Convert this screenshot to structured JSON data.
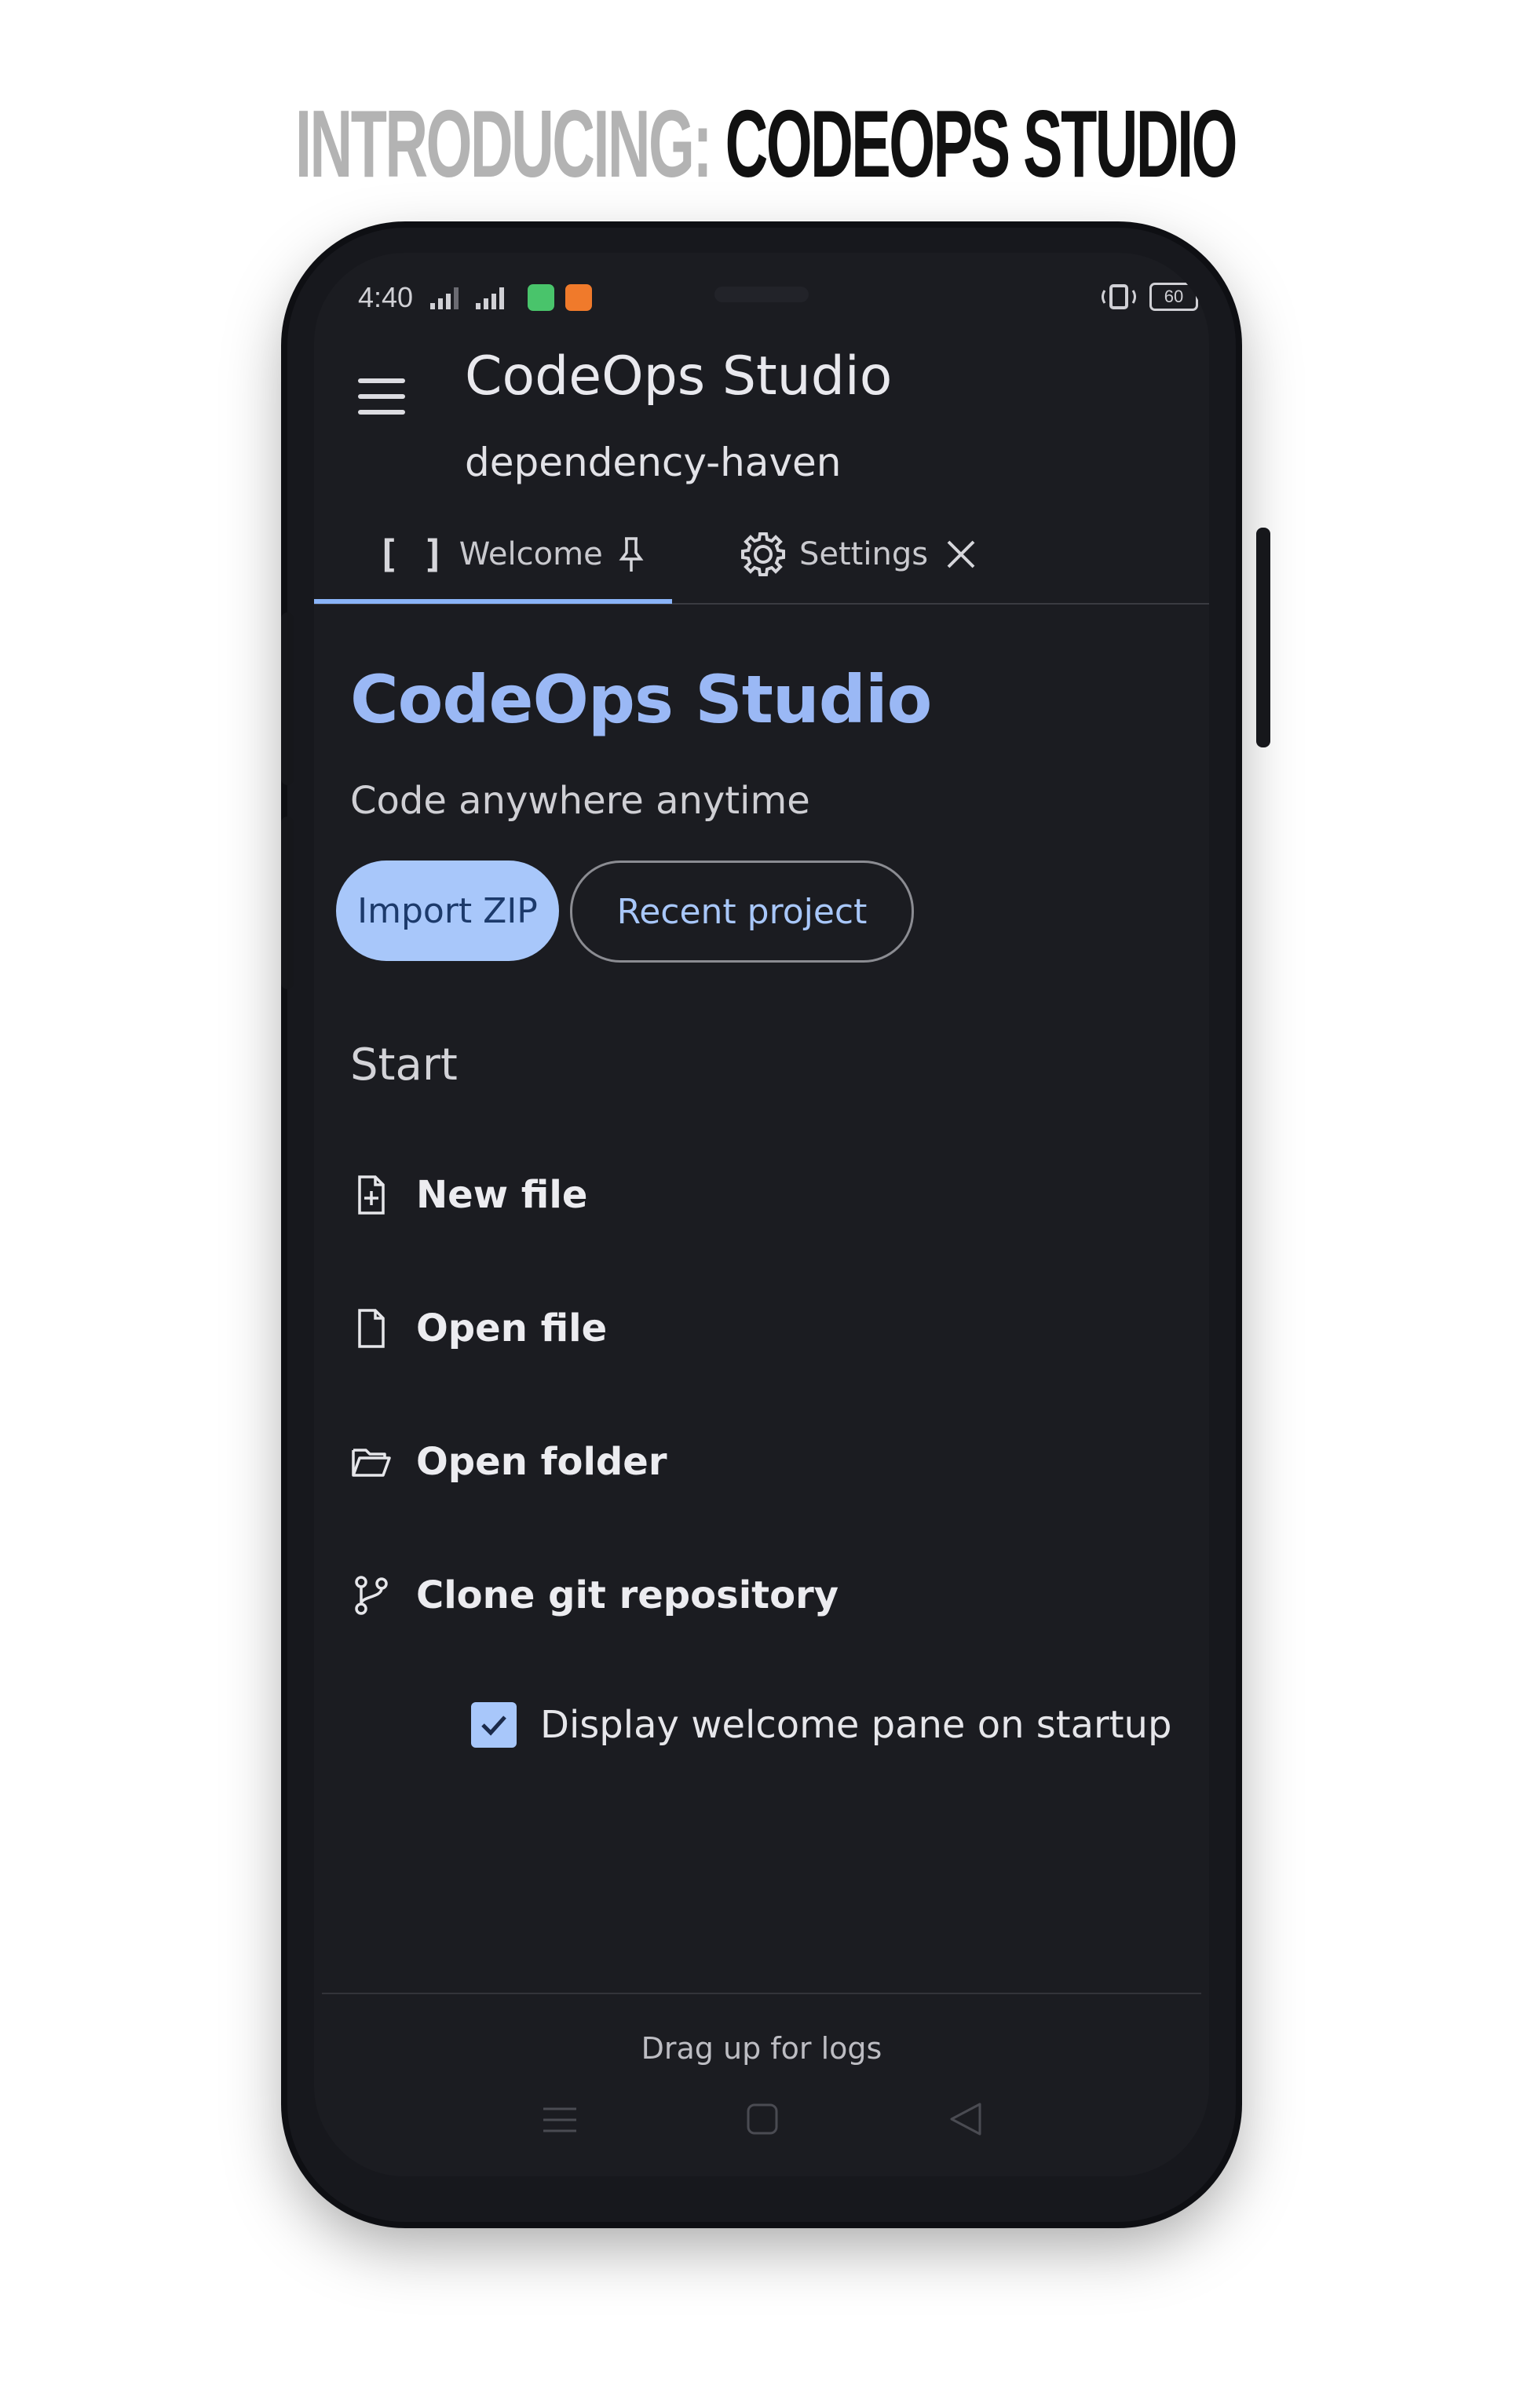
{
  "banner": {
    "prefix": "INTRODUCING:",
    "product": "CODEOPS STUDIO"
  },
  "status_bar": {
    "time": "4:40",
    "battery": "60"
  },
  "app_bar": {
    "title": "CodeOps Studio",
    "subtitle": "dependency-haven"
  },
  "tabs": [
    {
      "label": "Welcome",
      "icon": "brackets-icon",
      "action_icon": "pin-icon",
      "active": true
    },
    {
      "label": "Settings",
      "icon": "gear-icon",
      "action_icon": "close-icon",
      "active": false
    }
  ],
  "welcome": {
    "heading": "CodeOps Studio",
    "tagline": "Code anywhere anytime",
    "primary_button": "Import ZIP",
    "secondary_button": "Recent project",
    "section_title": "Start",
    "actions": [
      {
        "label": "New file",
        "icon": "file-plus-icon"
      },
      {
        "label": "Open file",
        "icon": "file-icon"
      },
      {
        "label": "Open folder",
        "icon": "folder-open-icon"
      },
      {
        "label": "Clone git repository",
        "icon": "git-branch-icon"
      }
    ],
    "startup_checkbox": {
      "label": "Display welcome pane on startup",
      "checked": true
    }
  },
  "logs_panel": {
    "hint": "Drag up for logs"
  },
  "colors": {
    "accent": "#a8c7fa",
    "heading": "#9ab8f5",
    "background": "#1b1c21"
  }
}
